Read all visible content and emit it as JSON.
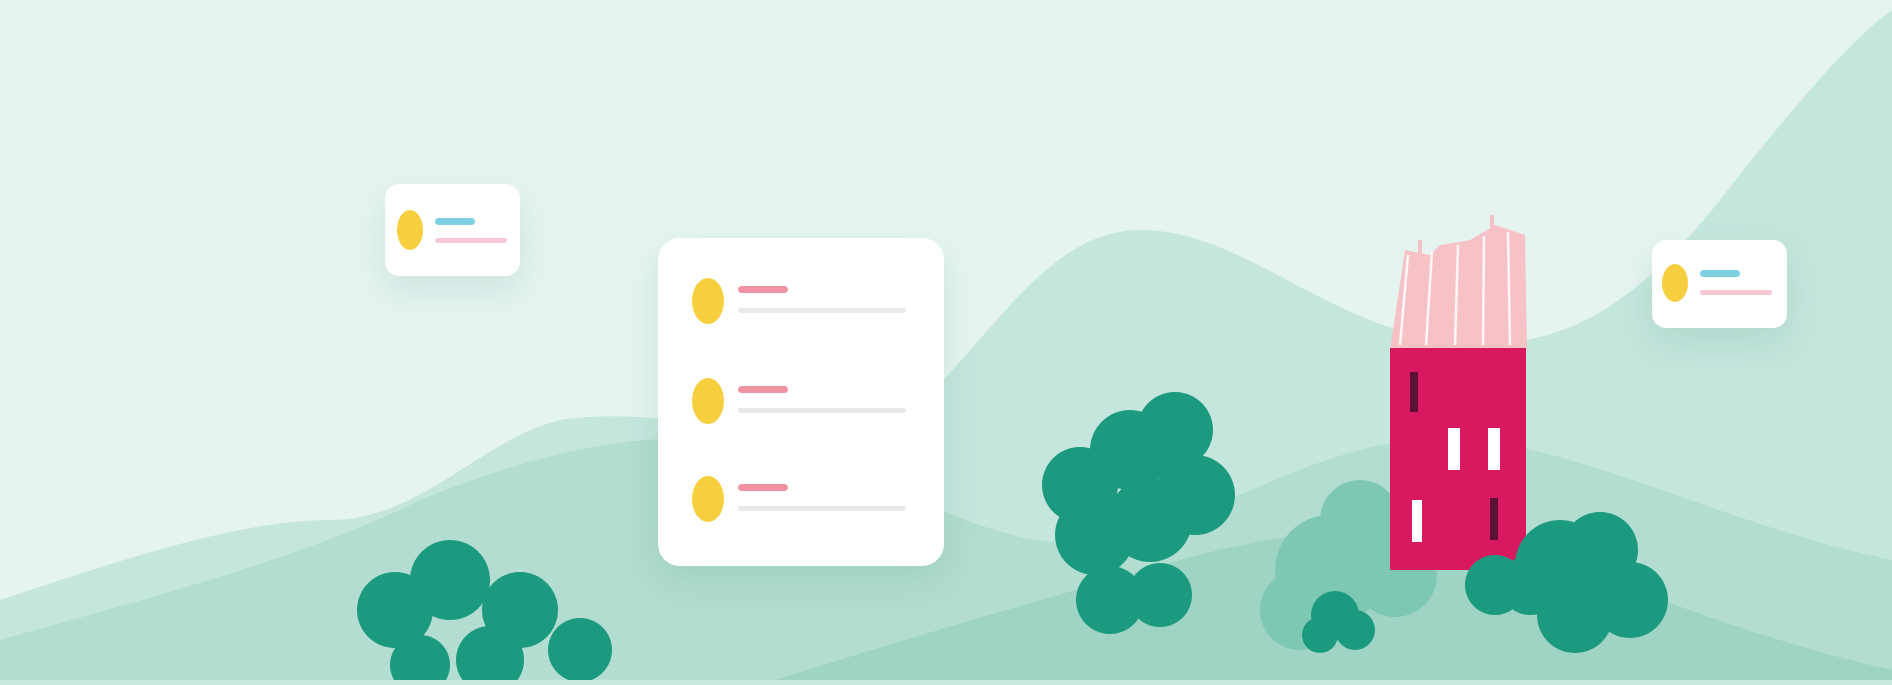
{
  "colors": {
    "sky": "#e6f4f1",
    "far_hill": "#c3e5dc",
    "mid_hill": "#afdccf",
    "near_hill": "#9ed3c3",
    "bush_dark": "#1c9a7f",
    "bush_light": "#7ec8b3",
    "house_wall": "#d8195f",
    "house_roof": "#f7c2c6",
    "card_accent_dot": "#f6cf3e",
    "card_line_blue": "#7fd0e2",
    "card_line_pink": "#f7c8d3",
    "card_line_red": "#ef7f93"
  },
  "illustration": {
    "elements": [
      "rolling-hills",
      "bushes",
      "house",
      "list-cards"
    ]
  },
  "cards": {
    "small_left": {
      "items": 1
    },
    "large": {
      "items": 3
    },
    "small_right": {
      "items": 1
    }
  }
}
